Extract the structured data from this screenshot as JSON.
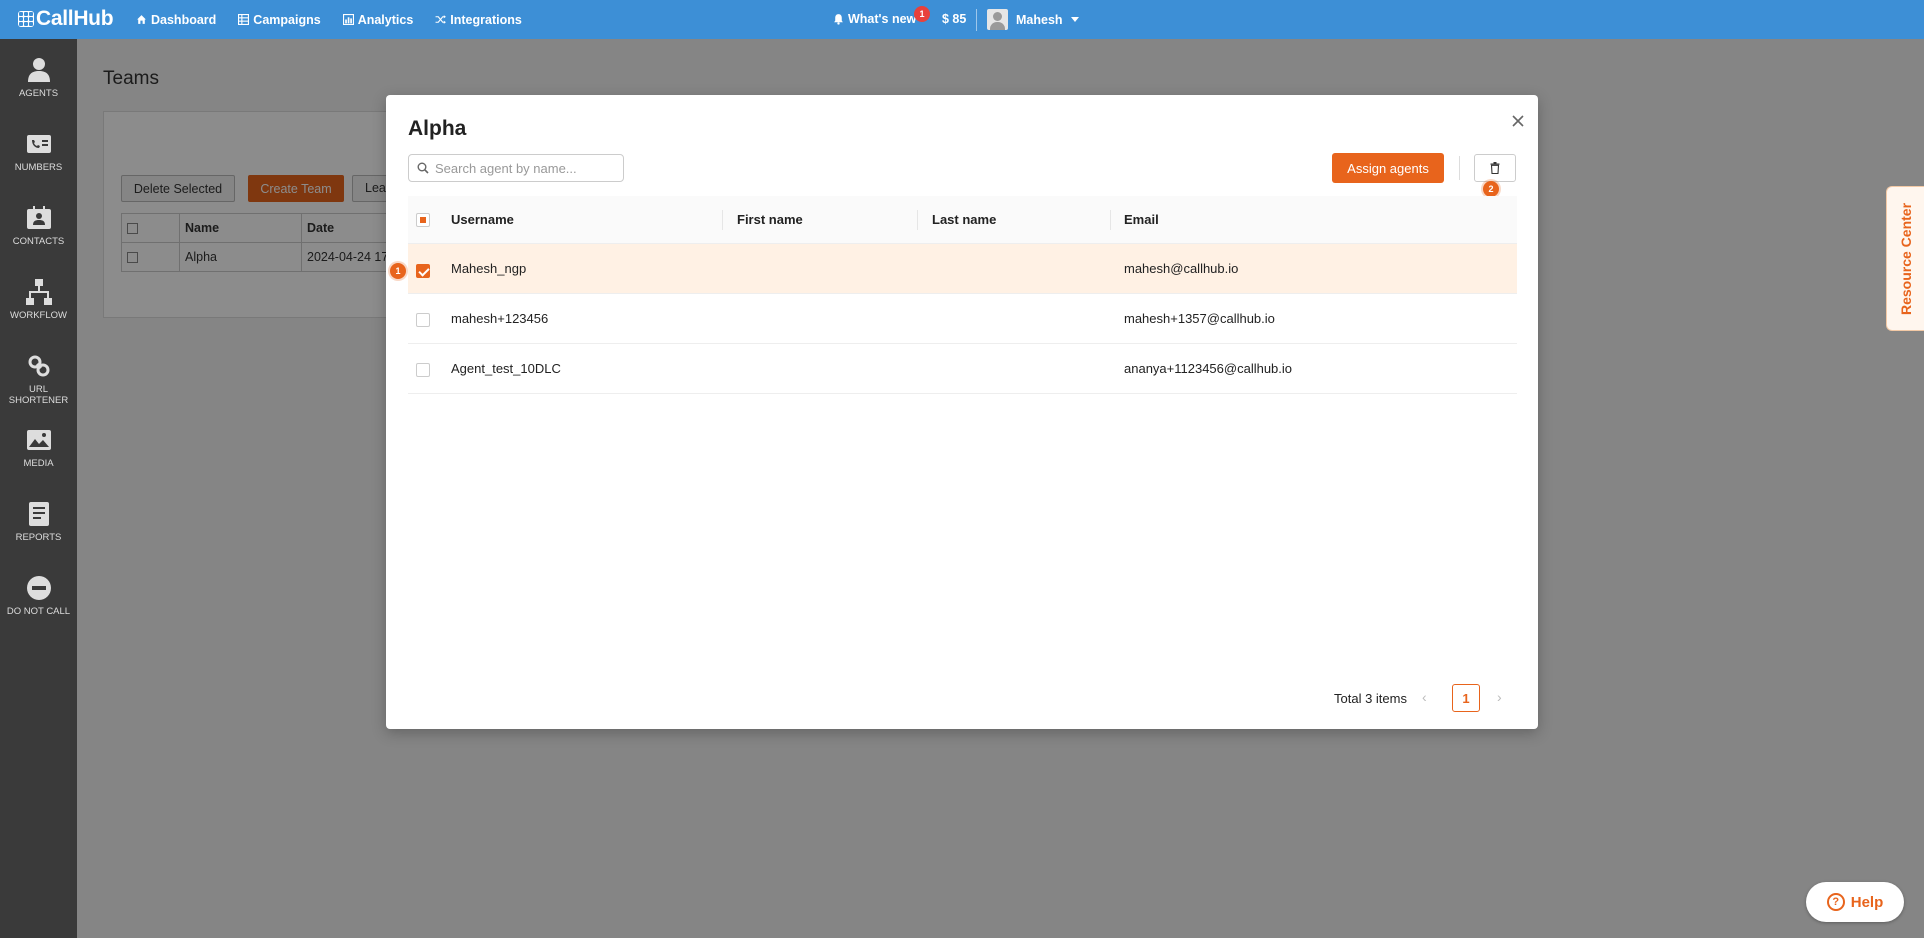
{
  "topbar": {
    "brand": "CallHub",
    "nav": [
      {
        "label": "Dashboard",
        "icon": "home-icon"
      },
      {
        "label": "Campaigns",
        "icon": "grid-icon"
      },
      {
        "label": "Analytics",
        "icon": "bar-chart-icon"
      },
      {
        "label": "Integrations",
        "icon": "shuffle-icon"
      }
    ],
    "whats_new": "What's new",
    "notification_count": "1",
    "balance": "$ 85",
    "user_name": "Mahesh"
  },
  "sidebar": {
    "items": [
      {
        "label": "AGENTS",
        "icon": "person-icon"
      },
      {
        "label": "NUMBERS",
        "icon": "phone-card-icon"
      },
      {
        "label": "CONTACTS",
        "icon": "contact-card-icon"
      },
      {
        "label": "WORKFLOW",
        "icon": "workflow-icon"
      },
      {
        "label": "URL SHORTENER",
        "icon": "link-icon"
      },
      {
        "label": "MEDIA",
        "icon": "image-icon"
      },
      {
        "label": "REPORTS",
        "icon": "report-icon"
      },
      {
        "label": "DO NOT CALL",
        "icon": "no-entry-icon"
      }
    ]
  },
  "page": {
    "title": "Teams",
    "delete_selected": "Delete Selected",
    "create_team": "Create Team",
    "third_button_partial": "Lea",
    "table": {
      "headers": [
        "Name",
        "Date"
      ],
      "rows": [
        {
          "name": "Alpha",
          "date": "2024-04-24 17"
        }
      ]
    }
  },
  "modal": {
    "title": "Alpha",
    "search_placeholder": "Search agent by name...",
    "assign_button": "Assign agents",
    "step_badges": [
      "1",
      "2"
    ],
    "columns": [
      "Username",
      "First name",
      "Last name",
      "Email"
    ],
    "rows": [
      {
        "username": "Mahesh_ngp",
        "first_name": "",
        "last_name": "",
        "email": "mahesh@callhub.io",
        "checked": true
      },
      {
        "username": "mahesh+123456",
        "first_name": "",
        "last_name": "",
        "email": "mahesh+1357@callhub.io",
        "checked": false
      },
      {
        "username": "Agent_test_10DLC",
        "first_name": "",
        "last_name": "",
        "email": "ananya+1123456@callhub.io",
        "checked": false
      }
    ],
    "total_text": "Total 3 items",
    "current_page": "1"
  },
  "resource_center": "Resource Center",
  "help": "Help",
  "colors": {
    "topbar": "#3d8fd6",
    "sidebar": "#3a3a3a",
    "accent": "#e8641c",
    "selected_row": "#fff1e4"
  }
}
